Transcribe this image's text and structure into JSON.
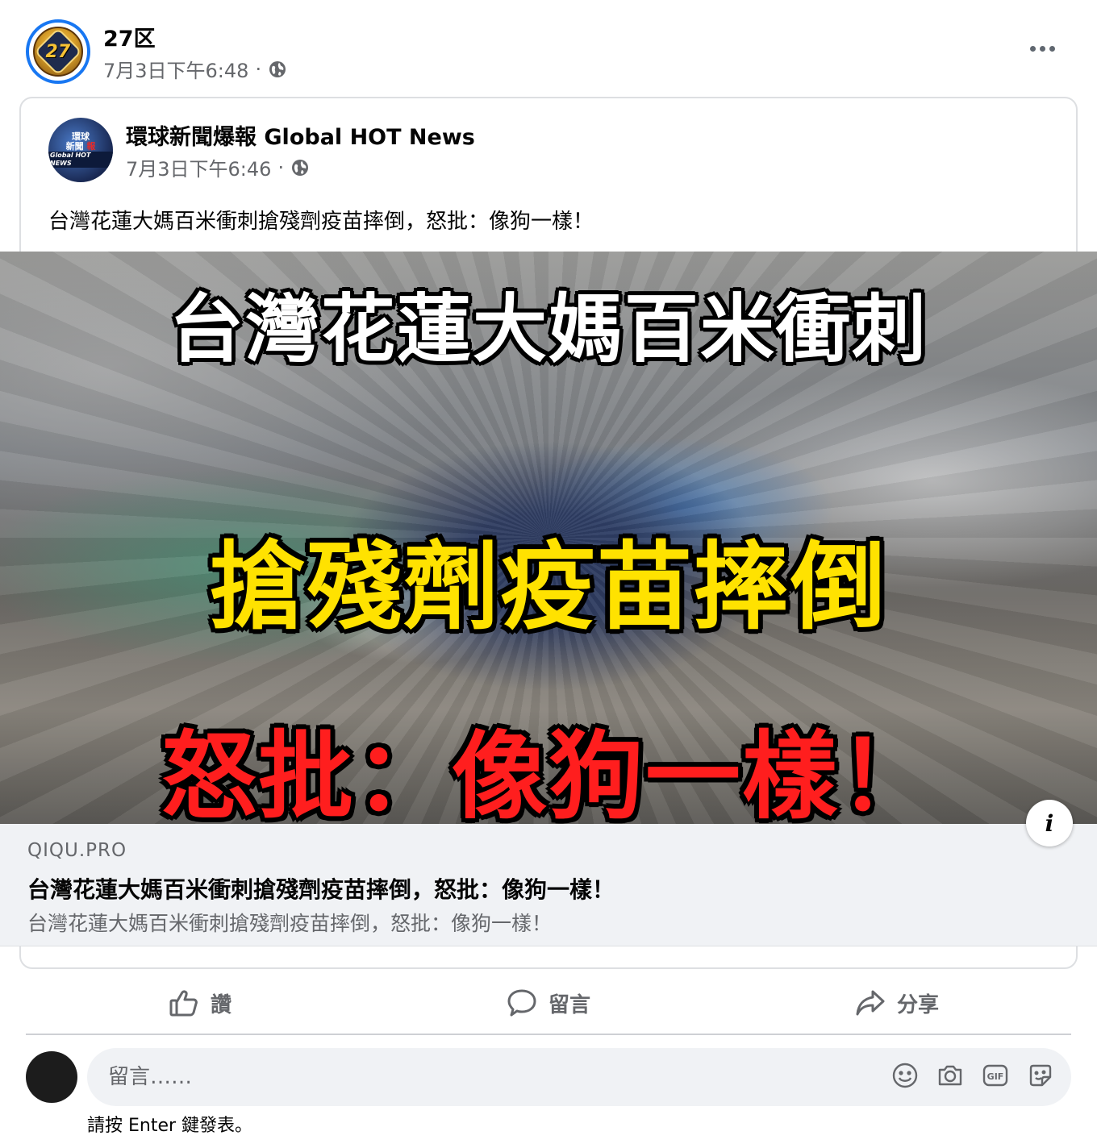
{
  "post": {
    "author": "27区",
    "time": "7月3日下午6:48",
    "separator": "·",
    "avatar_text": "27"
  },
  "shared": {
    "author": "環球新聞爆報 Global HOT News",
    "time": "7月3日下午6:46",
    "separator": "·",
    "text": "台灣花蓮大媽百米衝刺搶殘劑疫苗摔倒，怒批：像狗一樣！",
    "avatar_lines": [
      "環球",
      "新聞",
      "報",
      "Global HOT NEWS"
    ]
  },
  "image": {
    "line1": "台灣花蓮大媽百米衝刺",
    "line2": "搶殘劑疫苗摔倒",
    "line3": "怒批：像狗一樣！"
  },
  "link": {
    "domain": "QIQU.PRO",
    "title": "台灣花蓮大媽百米衝刺搶殘劑疫苗摔倒，怒批：像狗一樣！",
    "description": "台灣花蓮大媽百米衝刺搶殘劑疫苗摔倒，怒批：像狗一樣！",
    "info_label": "i"
  },
  "actions": {
    "like": "讚",
    "comment": "留言",
    "share": "分享"
  },
  "comment_box": {
    "placeholder": "留言……",
    "hint": "請按 Enter 鍵發表。"
  },
  "icons": {
    "globe": "globe-icon",
    "like": "thumbs-up-icon",
    "comment": "speech-bubble-icon",
    "share": "share-arrow-icon",
    "emoji": "emoji-icon",
    "camera": "camera-icon",
    "gif": "gif-icon",
    "sticker": "sticker-icon",
    "more": "more-icon",
    "info": "info-icon"
  },
  "colors": {
    "accent": "#1877f2",
    "secondary_text": "#65676b",
    "link_bg": "#f0f2f5",
    "overlay_white": "#ffffff",
    "overlay_yellow": "#ffe200",
    "overlay_red": "#ff1e1e"
  }
}
